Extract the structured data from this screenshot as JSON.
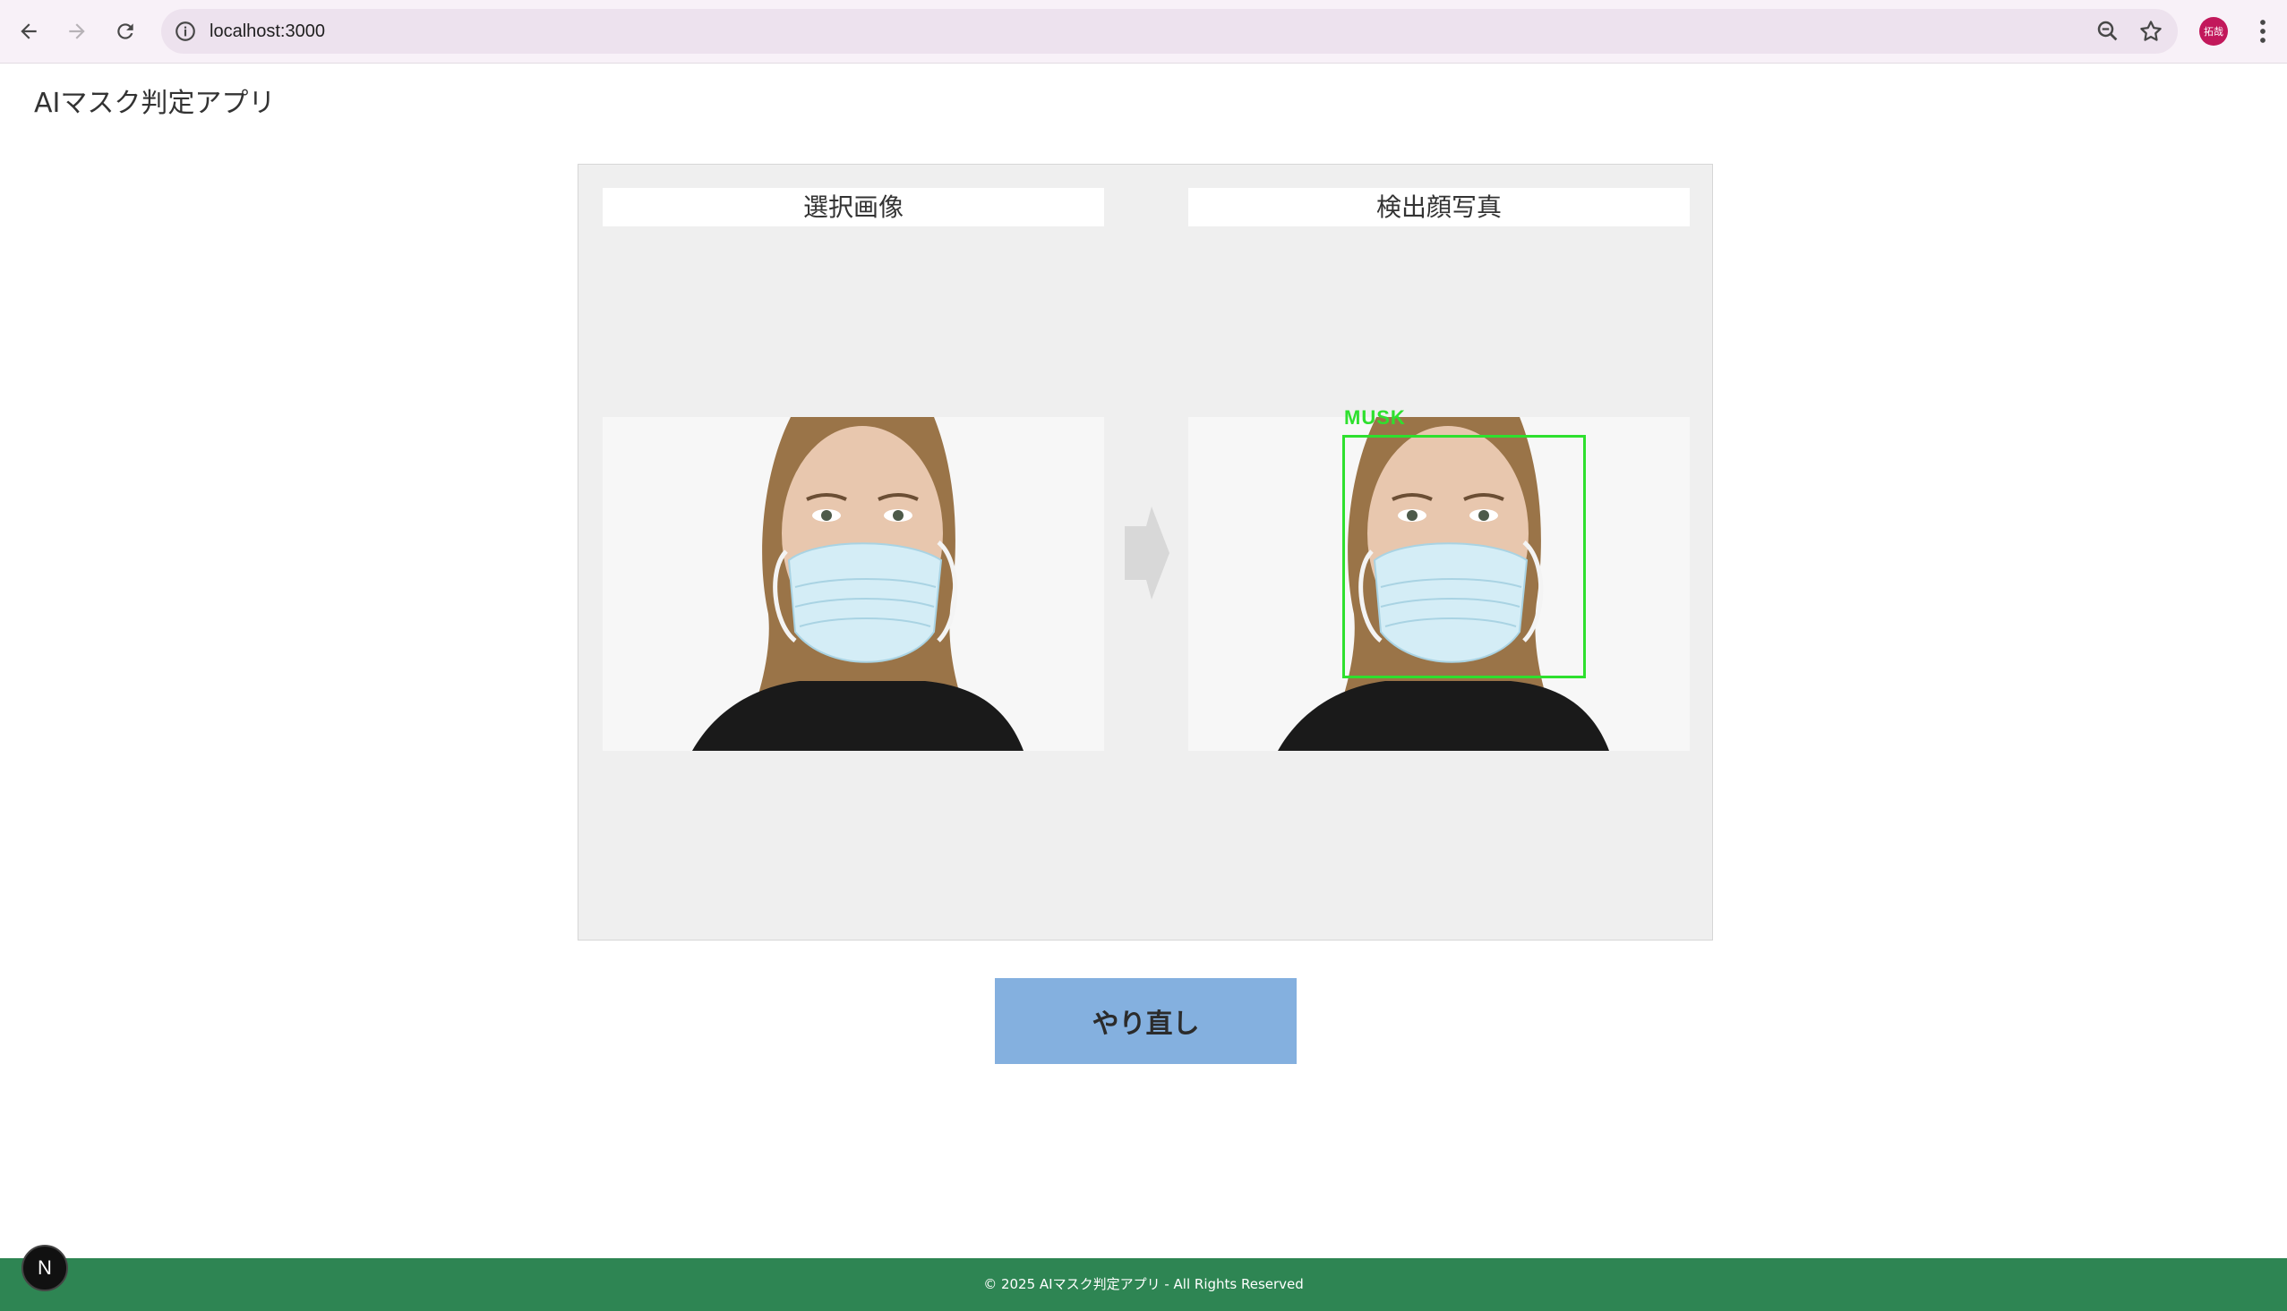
{
  "browser": {
    "url": "localhost:3000",
    "profile_initials": "拓哉"
  },
  "app": {
    "title": "AIマスク判定アプリ"
  },
  "panel": {
    "selected_label": "選択画像",
    "detected_label": "検出顔写真",
    "detection_tag": "MUSK"
  },
  "actions": {
    "retry_label": "やり直し"
  },
  "badge": {
    "letter": "N"
  },
  "footer": {
    "copyright": "© 2025 AIマスク判定アプリ - All Rights Reserved"
  }
}
